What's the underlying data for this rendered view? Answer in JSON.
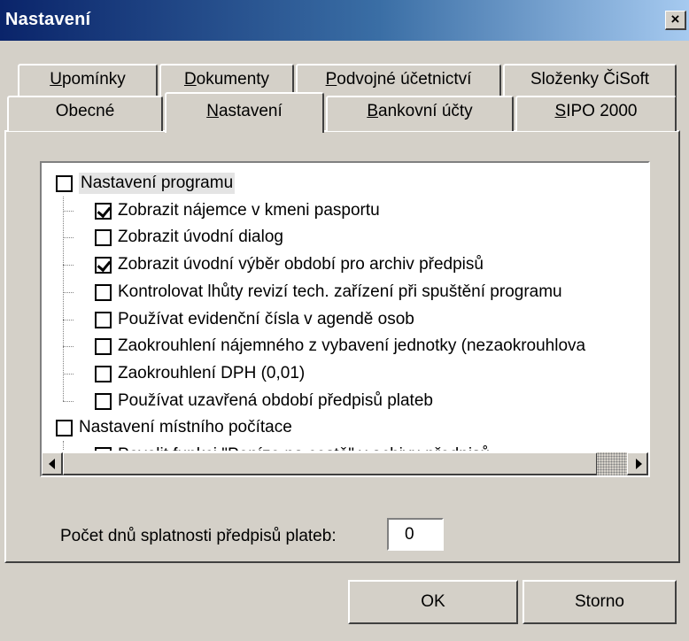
{
  "window": {
    "title": "Nastavení",
    "close_glyph": "×"
  },
  "tabs_back": [
    {
      "pre": "",
      "ul": "U",
      "post": "pomínky"
    },
    {
      "pre": "",
      "ul": "D",
      "post": "okumenty"
    },
    {
      "pre": "",
      "ul": "P",
      "post": "odvojné účetnictví"
    },
    {
      "pre": "Složenky ČiSoft",
      "ul": "",
      "post": ""
    }
  ],
  "tabs_front": [
    {
      "pre": "Obecné",
      "ul": "",
      "post": ""
    },
    {
      "pre": "",
      "ul": "N",
      "post": "astavení"
    },
    {
      "pre": "",
      "ul": "B",
      "post": "ankovní účty"
    },
    {
      "pre": "",
      "ul": "S",
      "post": "IPO 2000"
    }
  ],
  "tree": [
    {
      "label": "Nastavení programu",
      "checked": false,
      "level": 0
    },
    {
      "label": "Zobrazit nájemce v kmeni pasportu",
      "checked": true,
      "level": 1
    },
    {
      "label": "Zobrazit úvodní dialog",
      "checked": false,
      "level": 1
    },
    {
      "label": "Zobrazit úvodní výběr období pro archiv předpisů",
      "checked": true,
      "level": 1
    },
    {
      "label": "Kontrolovat lhůty revizí tech. zařízení při spuštění programu",
      "checked": false,
      "level": 1
    },
    {
      "label": "Používat evidenční čísla v agendě osob",
      "checked": false,
      "level": 1
    },
    {
      "label": "Zaokrouhlení nájemného z vybavení jednotky (nezaokrouhlova",
      "checked": false,
      "level": 1
    },
    {
      "label": "Zaokrouhlení DPH (0,01)",
      "checked": false,
      "level": 1
    },
    {
      "label": "Používat uzavřená období předpisů plateb",
      "checked": false,
      "level": 1
    },
    {
      "label": "Nastavení místního počítace",
      "checked": false,
      "level": 0
    },
    {
      "label": "Povolit funkci \"Peníze na cestě\" v achivu předpisů",
      "checked": false,
      "level": 1
    }
  ],
  "form": {
    "days_label": "Počet dnů splatnosti předpisů plateb:",
    "days_value": "0"
  },
  "buttons": {
    "ok": "OK",
    "cancel": "Storno"
  }
}
